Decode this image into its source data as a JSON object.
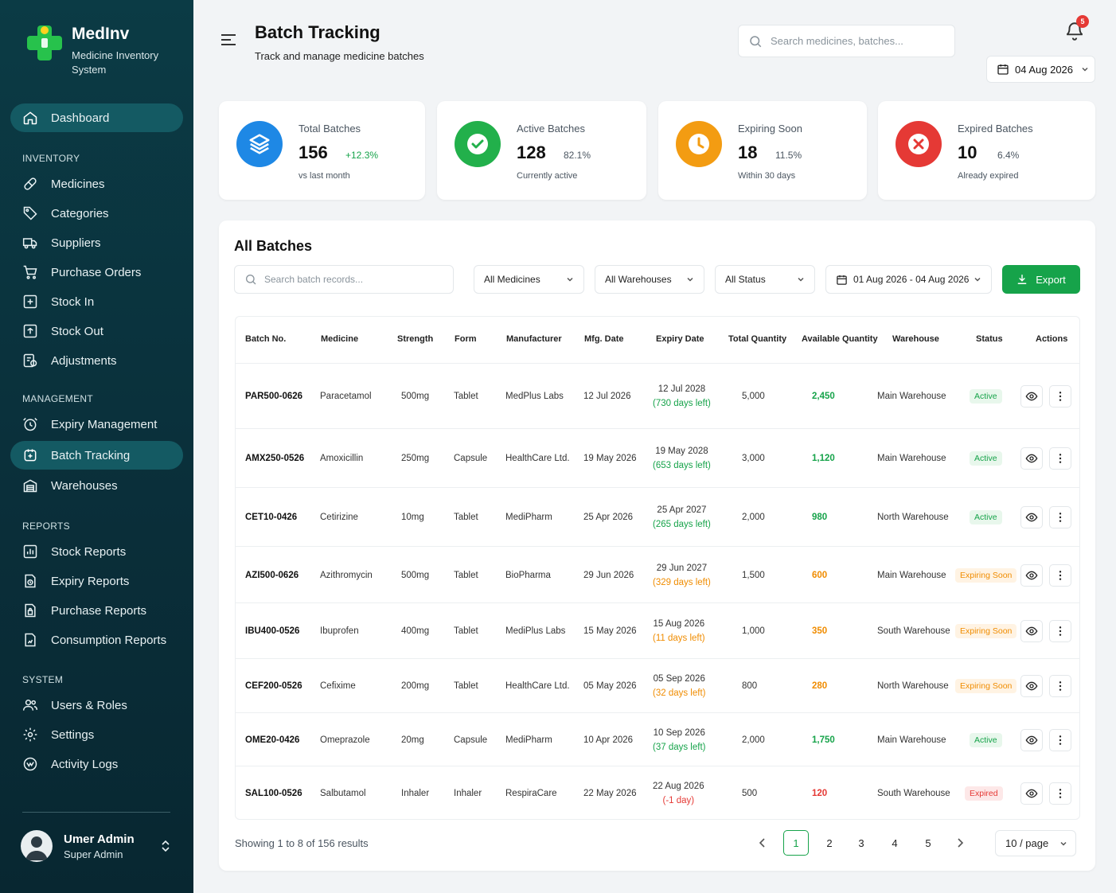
{
  "brand": {
    "name": "MedInv",
    "subtitle": "Medicine Inventory System"
  },
  "sidebar": {
    "dashboard": "Dashboard",
    "sections": {
      "inventory": "INVENTORY",
      "management": "MANAGEMENT",
      "reports": "REPORTS",
      "system": "SYSTEM"
    },
    "items": {
      "medicines": "Medicines",
      "categories": "Categories",
      "suppliers": "Suppliers",
      "purchase_orders": "Purchase Orders",
      "stock_in": "Stock In",
      "stock_out": "Stock Out",
      "adjustments": "Adjustments",
      "expiry_management": "Expiry Management",
      "batch_tracking": "Batch Tracking",
      "warehouses": "Warehouses",
      "stock_reports": "Stock Reports",
      "expiry_reports": "Expiry Reports",
      "purchase_reports": "Purchase Reports",
      "consumption_reports": "Consumption Reports",
      "users_roles": "Users & Roles",
      "settings": "Settings",
      "activity_logs": "Activity Logs"
    },
    "active": "batch_tracking"
  },
  "user": {
    "name": "Umer Admin",
    "role": "Super Admin"
  },
  "header": {
    "title": "Batch Tracking",
    "subtitle": "Track and manage medicine batches",
    "search_placeholder": "Search medicines, batches...",
    "notification_count": "5",
    "date": "04 Aug 2026"
  },
  "stats": [
    {
      "label": "Total Batches",
      "value": "156",
      "pct": "+12.3%",
      "note": "vs last month",
      "icon": "layers-icon",
      "color": "#1e88e5",
      "pct_color": "#16a34a"
    },
    {
      "label": "Active Batches",
      "value": "128",
      "pct": "82.1%",
      "note": "Currently active",
      "icon": "check-icon",
      "color": "#22b04b",
      "pct_color": "#4a5560"
    },
    {
      "label": "Expiring Soon",
      "value": "18",
      "pct": "11.5%",
      "note": "Within 30 days",
      "icon": "clock-icon",
      "color": "#f39c12",
      "pct_color": "#4a5560"
    },
    {
      "label": "Expired Batches",
      "value": "10",
      "pct": "6.4%",
      "note": "Already expired",
      "icon": "x-icon",
      "color": "#e53935",
      "pct_color": "#4a5560"
    }
  ],
  "batches": {
    "title": "All Batches",
    "search_placeholder": "Search batch records...",
    "filters": {
      "medicine": "All Medicines",
      "warehouse": "All Warehouses",
      "status": "All Status",
      "date_range": "01 Aug 2026 - 04 Aug 2026"
    },
    "export_label": "Export",
    "columns": [
      "Batch No.",
      "Medicine",
      "Strength",
      "Form",
      "Manufacturer",
      "Mfg. Date",
      "Expiry Date",
      "Total Quantity",
      "Available Quantity",
      "Warehouse",
      "Status",
      "Actions"
    ],
    "rows": [
      {
        "batch": "PAR500-0626",
        "medicine": "Paracetamol",
        "strength": "500mg",
        "form": "Tablet",
        "manufacturer": "MedPlus Labs",
        "mfg": "12 Jul 2026",
        "expiry": "12 Jul 2028",
        "days_left": "(730 days left)",
        "total": "5,000",
        "available": "2,450",
        "warehouse": "Main Warehouse",
        "status": "Active",
        "status_type": "active"
      },
      {
        "batch": "AMX250-0526",
        "medicine": "Amoxicillin",
        "strength": "250mg",
        "form": "Capsule",
        "manufacturer": "HealthCare Ltd.",
        "mfg": "19 May 2026",
        "expiry": "19 May 2028",
        "days_left": "(653 days left)",
        "total": "3,000",
        "available": "1,120",
        "warehouse": "Main Warehouse",
        "status": "Active",
        "status_type": "active"
      },
      {
        "batch": "CET10-0426",
        "medicine": "Cetirizine",
        "strength": "10mg",
        "form": "Tablet",
        "manufacturer": "MediPharm",
        "mfg": "25 Apr 2026",
        "expiry": "25 Apr 2027",
        "days_left": "(265 days left)",
        "total": "2,000",
        "available": "980",
        "warehouse": "North Warehouse",
        "status": "Active",
        "status_type": "active"
      },
      {
        "batch": "AZI500-0626",
        "medicine": "Azithromycin",
        "strength": "500mg",
        "form": "Tablet",
        "manufacturer": "BioPharma",
        "mfg": "29 Jun 2026",
        "expiry": "29 Jun 2027",
        "days_left": "(329 days left)",
        "total": "1,500",
        "available": "600",
        "warehouse": "Main Warehouse",
        "status": "Expiring Soon",
        "status_type": "soon"
      },
      {
        "batch": "IBU400-0526",
        "medicine": "Ibuprofen",
        "strength": "400mg",
        "form": "Tablet",
        "manufacturer": "MediPlus Labs",
        "mfg": "15 May 2026",
        "expiry": "15 Aug 2026",
        "days_left": "(11 days left)",
        "total": "1,000",
        "available": "350",
        "warehouse": "South Warehouse",
        "status": "Expiring Soon",
        "status_type": "soon"
      },
      {
        "batch": "CEF200-0526",
        "medicine": "Cefixime",
        "strength": "200mg",
        "form": "Tablet",
        "manufacturer": "HealthCare Ltd.",
        "mfg": "05 May 2026",
        "expiry": "05 Sep 2026",
        "days_left": "(32 days left)",
        "total": "800",
        "available": "280",
        "warehouse": "North Warehouse",
        "status": "Expiring Soon",
        "status_type": "soon"
      },
      {
        "batch": "OME20-0426",
        "medicine": "Omeprazole",
        "strength": "20mg",
        "form": "Capsule",
        "manufacturer": "MediPharm",
        "mfg": "10 Apr 2026",
        "expiry": "10 Sep 2026",
        "days_left": "(37 days left)",
        "total": "2,000",
        "available": "1,750",
        "warehouse": "Main Warehouse",
        "status": "Active",
        "status_type": "active"
      },
      {
        "batch": "SAL100-0526",
        "medicine": "Salbutamol",
        "strength": "Inhaler",
        "form": "Inhaler",
        "manufacturer": "RespiraCare",
        "mfg": "22 May 2026",
        "expiry": "22 Aug 2026",
        "days_left": "(-1 day)",
        "total": "500",
        "available": "120",
        "warehouse": "South Warehouse",
        "status": "Expired",
        "status_type": "expired"
      }
    ],
    "showing": "Showing 1 to 8 of 156 results",
    "pages": [
      "1",
      "2",
      "3",
      "4",
      "5"
    ],
    "current_page": "1",
    "per_page": "10 / page"
  }
}
